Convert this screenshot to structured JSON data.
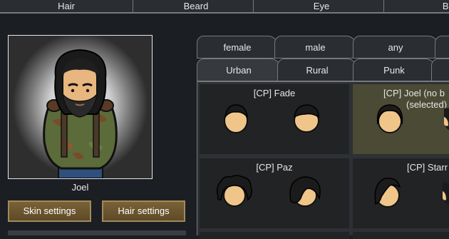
{
  "top_tabs": [
    "Hair",
    "Beard",
    "Eye",
    "Bro"
  ],
  "pawn": {
    "name": "Joel"
  },
  "buttons": {
    "skin": "Skin settings",
    "hair": "Hair settings"
  },
  "gender_tabs": [
    "female",
    "male",
    "any"
  ],
  "style_tabs": [
    "Urban",
    "Rural",
    "Punk"
  ],
  "styles": [
    {
      "label": "[CP] Fade",
      "selected": false
    },
    {
      "label": "[CP] Joel (no b",
      "sub": "(selected)",
      "selected": true
    },
    {
      "label": "[CP] Paz",
      "selected": false
    },
    {
      "label": "[CP] Starr",
      "selected": false
    }
  ],
  "colors": {
    "selected_bg": "#4b4a35",
    "button_bg": "#6b5530",
    "skin": "#f0c58a"
  }
}
